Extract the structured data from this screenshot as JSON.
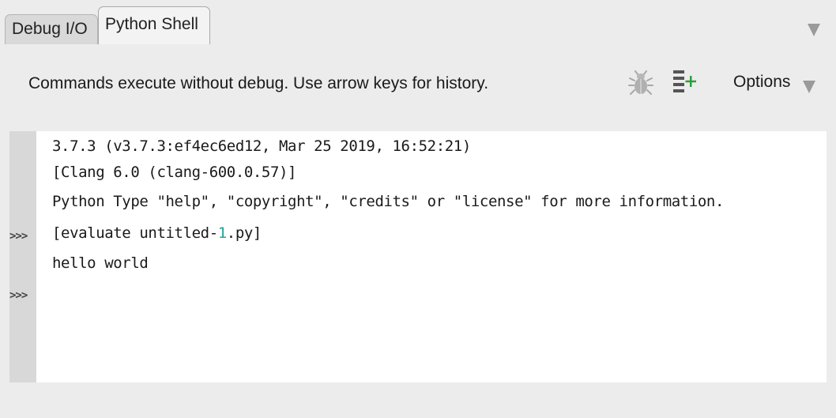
{
  "tabs": [
    {
      "label": "Debug I/O",
      "active": false
    },
    {
      "label": "Python Shell",
      "active": true
    }
  ],
  "toolbar": {
    "hint": "Commands execute without debug.  Use arrow keys for history.",
    "bug_icon": "bug-icon",
    "indent_icon": "indent-add-icon",
    "options_label": "Options"
  },
  "shell": {
    "prompt": ">>>",
    "lines": [
      "3.7.3 (v3.7.3:ef4ec6ed12, Mar 25 2019, 16:52:21)",
      "[Clang 6.0 (clang-600.0.57)]",
      "Python Type \"help\", \"copyright\", \"credits\" or \"license\" for more information."
    ],
    "evaluate_prefix": "[evaluate untitled-",
    "evaluate_number": "1",
    "evaluate_suffix": ".py]",
    "output": "hello world"
  },
  "colors": {
    "background": "#ececec",
    "shell_background": "#ffffff",
    "gutter": "#d8d8d8",
    "number_highlight": "#2aa198",
    "icon_green": "#2e9e3a"
  }
}
